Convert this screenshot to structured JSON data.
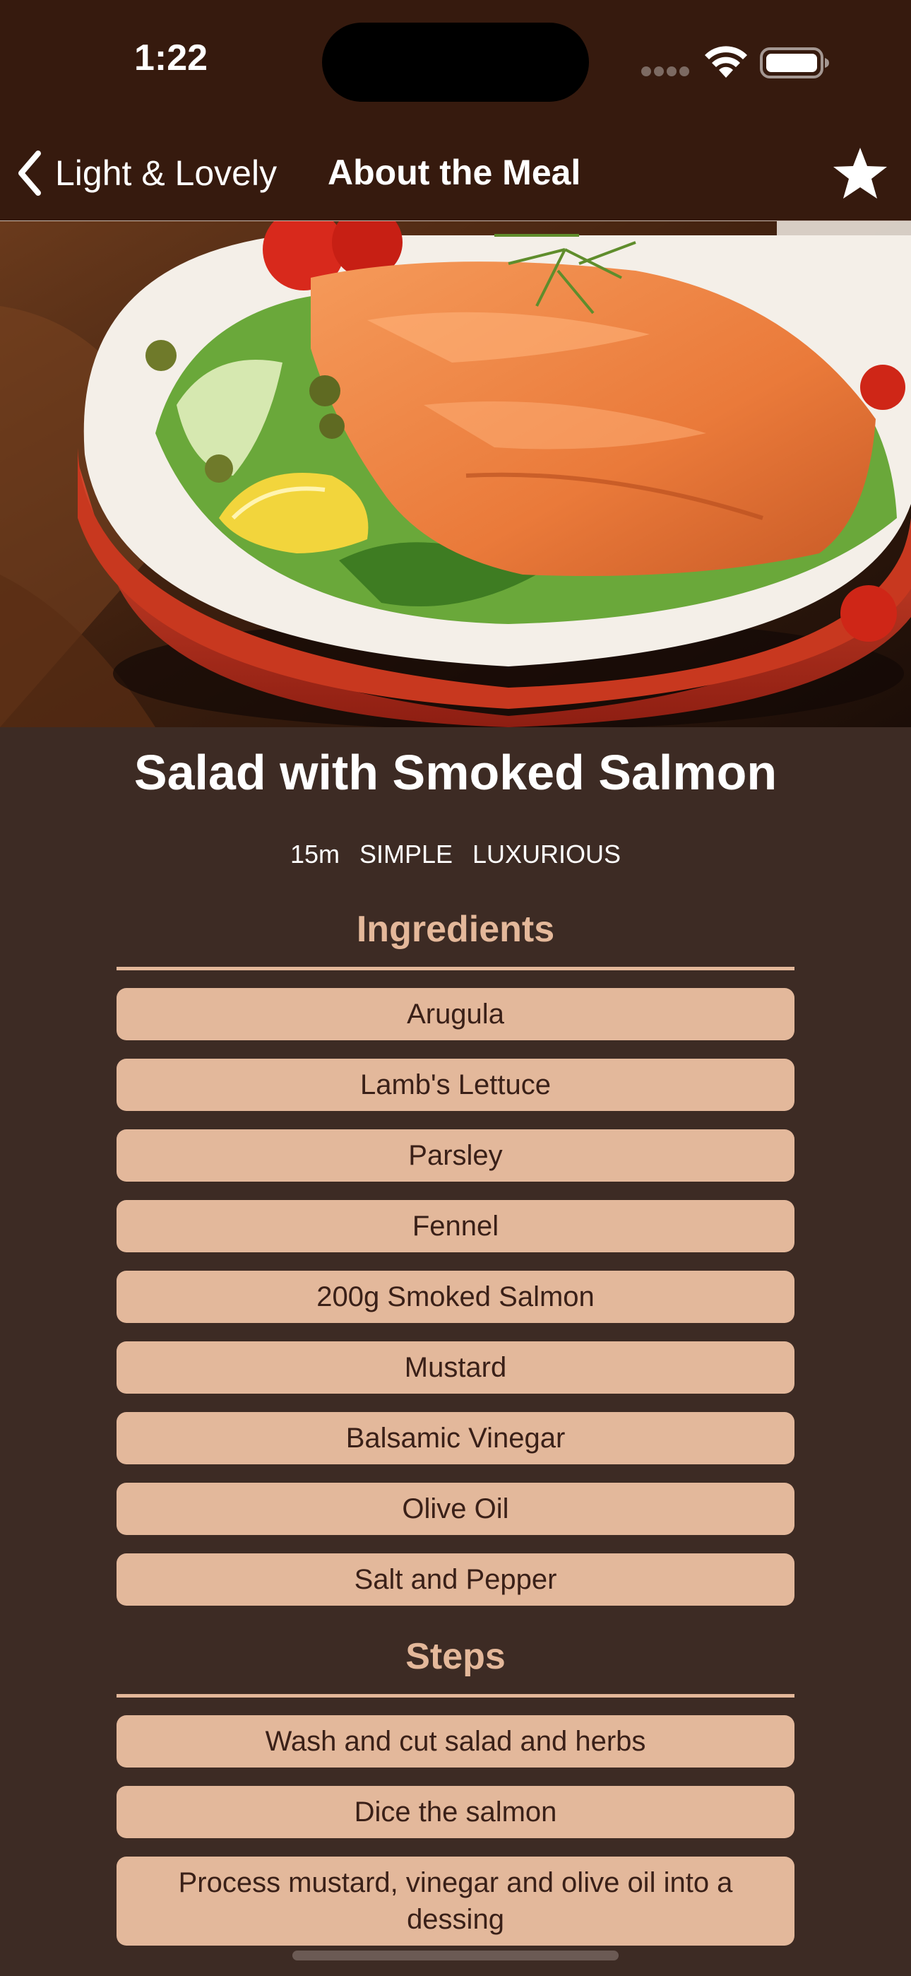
{
  "status_bar": {
    "time": "1:22",
    "icons": [
      "signal-dots-icon",
      "wifi-icon",
      "battery-icon"
    ]
  },
  "nav": {
    "back_label": "Light & Lovely",
    "title": "About the Meal",
    "favorite_icon": "star-icon"
  },
  "meal": {
    "title": "Salad with Smoked Salmon",
    "duration": "15m",
    "complexity": "SIMPLE",
    "affordability": "LUXURIOUS"
  },
  "ingredients": {
    "heading": "Ingredients",
    "items": [
      "Arugula",
      "Lamb's Lettuce",
      "Parsley",
      "Fennel",
      "200g Smoked Salmon",
      "Mustard",
      "Balsamic Vinegar",
      "Olive Oil",
      "Salt and Pepper"
    ]
  },
  "steps": {
    "heading": "Steps",
    "items": [
      "Wash and cut salad and herbs",
      "Dice the salmon",
      "Process mustard, vinegar and olive oil into a dessing"
    ]
  },
  "colors": {
    "nav_background": "#361a0e",
    "page_background": "#3d2b24",
    "accent": "#e4b89a",
    "pill_background": "#e3b89b",
    "pill_text": "#3a2018"
  }
}
